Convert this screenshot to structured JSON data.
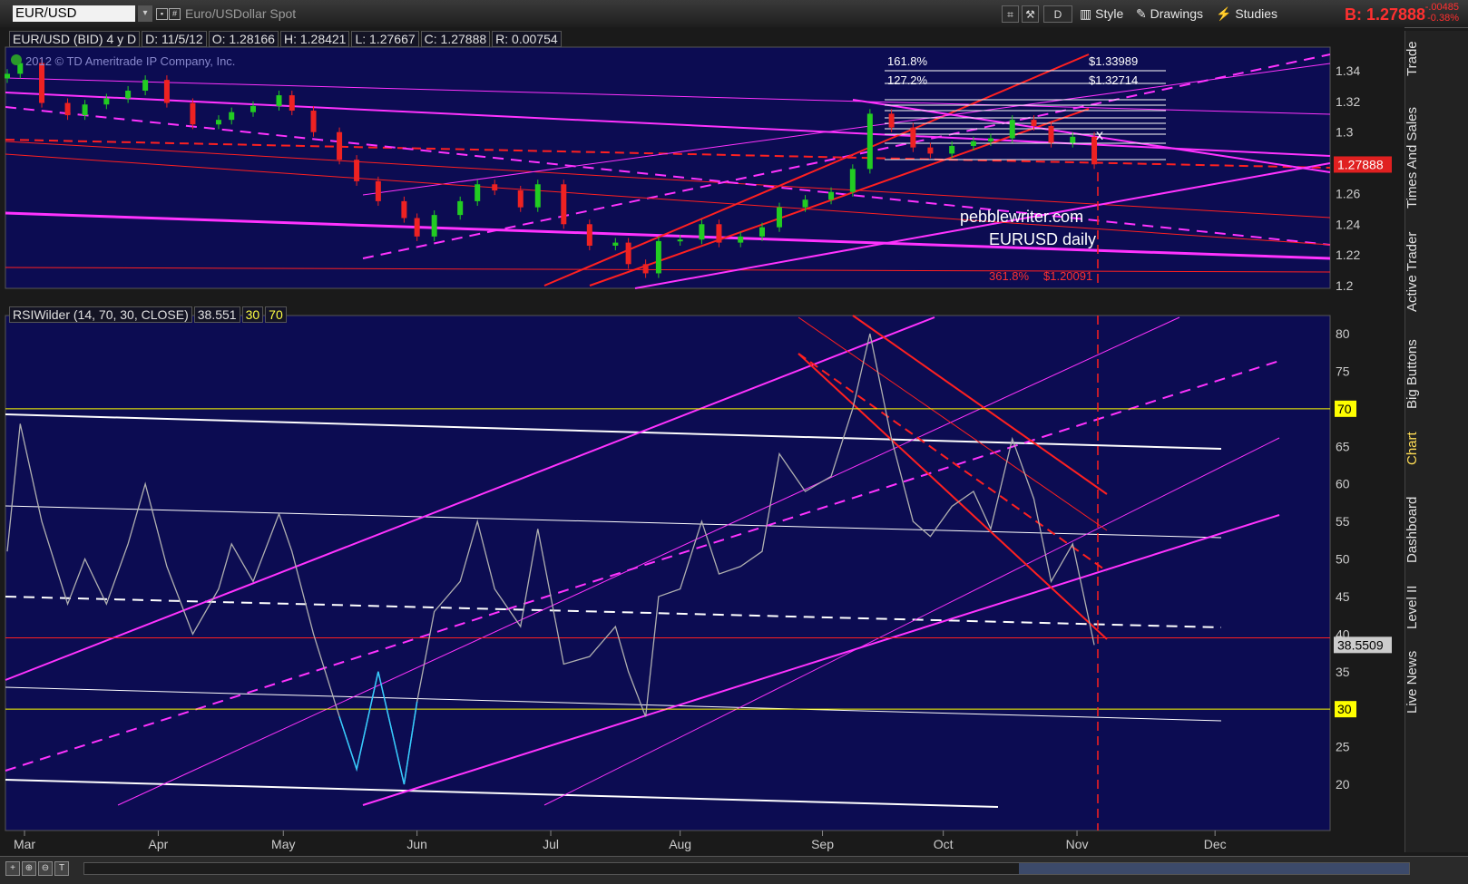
{
  "toolbar": {
    "symbol": "EUR/USD",
    "description": "Euro/USDollar Spot",
    "style_label": "Style",
    "drawings_label": "Drawings",
    "studies_label": "Studies",
    "bid_label": "B: 1.27888",
    "change_abs": "-.00485",
    "change_pct": "-0.38%"
  },
  "price_header": {
    "title": "EUR/USD (BID) 4 y D",
    "date": "D: 11/5/12",
    "open": "O: 1.28166",
    "high": "H: 1.28421",
    "low": "L: 1.27667",
    "close": "C: 1.27888",
    "range": "R: 0.00754"
  },
  "copyright": "2012 © TD Ameritrade IP Company, Inc.",
  "annotations": {
    "site": "pebblewriter.com",
    "subtitle": "EURUSD daily",
    "fib_161": "161.8%",
    "fib_161_val": "$1.33989",
    "fib_127": "127.2%",
    "fib_127_val": "$1.32714",
    "fib_361": "361.8%",
    "fib_361_val": "$1.20091",
    "marker_x": "x"
  },
  "rsi_header": {
    "label": "RSIWilder (14, 70, 30, CLOSE)",
    "value": "38.551",
    "lower": "30",
    "upper": "70"
  },
  "right_tabs": [
    "Trade",
    "Times And Sales",
    "Active Trader",
    "Big Buttons",
    "Chart",
    "Dashboard",
    "Level II",
    "Live News"
  ],
  "active_tab": "Chart",
  "colors": {
    "plot_bg": "#0c0c52",
    "magenta": "#ff33ff",
    "red": "#ff2020",
    "candle_up": "#22cc22",
    "candle_down": "#ee2222",
    "rsi_line": "#b0b0b0",
    "rsi_oversold": "#33ccff",
    "level_yellow": "#ffff00"
  },
  "chart_data": [
    {
      "type": "candlestick",
      "title": "EUR/USD (BID) 4 y D",
      "x_ticks": [
        "Mar",
        "Apr",
        "May",
        "Jun",
        "Jul",
        "Aug",
        "Sep",
        "Oct",
        "Nov",
        "Dec"
      ],
      "y_ticks": [
        "1.34",
        "1.32",
        "1.3",
        "1.28",
        "1.26",
        "1.24",
        "1.22",
        "1.2"
      ],
      "ylim": [
        1.2,
        1.35
      ],
      "last_price": "1.27888",
      "grid": false,
      "close_series": [
        {
          "date": "2012-02-27",
          "close": 1.338
        },
        {
          "date": "2012-03-01",
          "close": 1.345
        },
        {
          "date": "2012-03-06",
          "close": 1.319
        },
        {
          "date": "2012-03-12",
          "close": 1.311
        },
        {
          "date": "2012-03-16",
          "close": 1.318
        },
        {
          "date": "2012-03-21",
          "close": 1.322
        },
        {
          "date": "2012-03-26",
          "close": 1.327
        },
        {
          "date": "2012-03-30",
          "close": 1.334
        },
        {
          "date": "2012-04-04",
          "close": 1.319
        },
        {
          "date": "2012-04-10",
          "close": 1.305
        },
        {
          "date": "2012-04-16",
          "close": 1.308
        },
        {
          "date": "2012-04-19",
          "close": 1.313
        },
        {
          "date": "2012-04-24",
          "close": 1.317
        },
        {
          "date": "2012-04-30",
          "close": 1.324
        },
        {
          "date": "2012-05-03",
          "close": 1.314
        },
        {
          "date": "2012-05-08",
          "close": 1.3
        },
        {
          "date": "2012-05-14",
          "close": 1.282
        },
        {
          "date": "2012-05-18",
          "close": 1.268
        },
        {
          "date": "2012-05-23",
          "close": 1.255
        },
        {
          "date": "2012-05-29",
          "close": 1.244
        },
        {
          "date": "2012-06-01",
          "close": 1.232
        },
        {
          "date": "2012-06-05",
          "close": 1.246
        },
        {
          "date": "2012-06-11",
          "close": 1.255
        },
        {
          "date": "2012-06-15",
          "close": 1.266
        },
        {
          "date": "2012-06-19",
          "close": 1.262
        },
        {
          "date": "2012-06-25",
          "close": 1.251
        },
        {
          "date": "2012-06-29",
          "close": 1.266
        },
        {
          "date": "2012-07-05",
          "close": 1.24
        },
        {
          "date": "2012-07-11",
          "close": 1.226
        },
        {
          "date": "2012-07-17",
          "close": 1.228
        },
        {
          "date": "2012-07-20",
          "close": 1.214
        },
        {
          "date": "2012-07-24",
          "close": 1.208
        },
        {
          "date": "2012-07-27",
          "close": 1.229
        },
        {
          "date": "2012-08-01",
          "close": 1.23
        },
        {
          "date": "2012-08-06",
          "close": 1.24
        },
        {
          "date": "2012-08-10",
          "close": 1.228
        },
        {
          "date": "2012-08-15",
          "close": 1.232
        },
        {
          "date": "2012-08-20",
          "close": 1.238
        },
        {
          "date": "2012-08-24",
          "close": 1.251
        },
        {
          "date": "2012-08-30",
          "close": 1.256
        },
        {
          "date": "2012-09-05",
          "close": 1.261
        },
        {
          "date": "2012-09-10",
          "close": 1.276
        },
        {
          "date": "2012-09-14",
          "close": 1.312
        },
        {
          "date": "2012-09-19",
          "close": 1.303
        },
        {
          "date": "2012-09-24",
          "close": 1.29
        },
        {
          "date": "2012-09-28",
          "close": 1.286
        },
        {
          "date": "2012-10-03",
          "close": 1.291
        },
        {
          "date": "2012-10-08",
          "close": 1.294
        },
        {
          "date": "2012-10-12",
          "close": 1.296
        },
        {
          "date": "2012-10-17",
          "close": 1.308
        },
        {
          "date": "2012-10-22",
          "close": 1.304
        },
        {
          "date": "2012-10-26",
          "close": 1.293
        },
        {
          "date": "2012-10-31",
          "close": 1.297
        },
        {
          "date": "2012-11-05",
          "close": 1.279
        }
      ]
    },
    {
      "type": "line",
      "title": "RSIWilder (14, 70, 30, CLOSE)",
      "y_ticks": [
        "80",
        "75",
        "70",
        "65",
        "60",
        "55",
        "50",
        "45",
        "40",
        "35",
        "30",
        "25",
        "20"
      ],
      "ylim": [
        17,
        84
      ],
      "levels": [
        70,
        30
      ],
      "last_value": "38.5509",
      "series": [
        {
          "date": "2012-02-27",
          "rsi": 51
        },
        {
          "date": "2012-03-01",
          "rsi": 68
        },
        {
          "date": "2012-03-06",
          "rsi": 55
        },
        {
          "date": "2012-03-12",
          "rsi": 44
        },
        {
          "date": "2012-03-16",
          "rsi": 50
        },
        {
          "date": "2012-03-21",
          "rsi": 44
        },
        {
          "date": "2012-03-26",
          "rsi": 52
        },
        {
          "date": "2012-03-30",
          "rsi": 60
        },
        {
          "date": "2012-04-04",
          "rsi": 49
        },
        {
          "date": "2012-04-10",
          "rsi": 40
        },
        {
          "date": "2012-04-16",
          "rsi": 46
        },
        {
          "date": "2012-04-19",
          "rsi": 52
        },
        {
          "date": "2012-04-24",
          "rsi": 47
        },
        {
          "date": "2012-04-30",
          "rsi": 56
        },
        {
          "date": "2012-05-03",
          "rsi": 51
        },
        {
          "date": "2012-05-08",
          "rsi": 40
        },
        {
          "date": "2012-05-14",
          "rsi": 29
        },
        {
          "date": "2012-05-18",
          "rsi": 22
        },
        {
          "date": "2012-05-23",
          "rsi": 35
        },
        {
          "date": "2012-05-29",
          "rsi": 20
        },
        {
          "date": "2012-06-01",
          "rsi": 31
        },
        {
          "date": "2012-06-05",
          "rsi": 43
        },
        {
          "date": "2012-06-11",
          "rsi": 47
        },
        {
          "date": "2012-06-15",
          "rsi": 55
        },
        {
          "date": "2012-06-19",
          "rsi": 46
        },
        {
          "date": "2012-06-25",
          "rsi": 41
        },
        {
          "date": "2012-06-29",
          "rsi": 54
        },
        {
          "date": "2012-07-05",
          "rsi": 36
        },
        {
          "date": "2012-07-11",
          "rsi": 37
        },
        {
          "date": "2012-07-17",
          "rsi": 41
        },
        {
          "date": "2012-07-20",
          "rsi": 35
        },
        {
          "date": "2012-07-24",
          "rsi": 29
        },
        {
          "date": "2012-07-27",
          "rsi": 45
        },
        {
          "date": "2012-08-01",
          "rsi": 46
        },
        {
          "date": "2012-08-06",
          "rsi": 55
        },
        {
          "date": "2012-08-10",
          "rsi": 48
        },
        {
          "date": "2012-08-15",
          "rsi": 49
        },
        {
          "date": "2012-08-20",
          "rsi": 51
        },
        {
          "date": "2012-08-24",
          "rsi": 64
        },
        {
          "date": "2012-08-30",
          "rsi": 59
        },
        {
          "date": "2012-09-05",
          "rsi": 61
        },
        {
          "date": "2012-09-10",
          "rsi": 70
        },
        {
          "date": "2012-09-14",
          "rsi": 80
        },
        {
          "date": "2012-09-19",
          "rsi": 66
        },
        {
          "date": "2012-09-24",
          "rsi": 55
        },
        {
          "date": "2012-09-28",
          "rsi": 53
        },
        {
          "date": "2012-10-03",
          "rsi": 57
        },
        {
          "date": "2012-10-08",
          "rsi": 59
        },
        {
          "date": "2012-10-12",
          "rsi": 54
        },
        {
          "date": "2012-10-17",
          "rsi": 66
        },
        {
          "date": "2012-10-22",
          "rsi": 58
        },
        {
          "date": "2012-10-26",
          "rsi": 47
        },
        {
          "date": "2012-10-31",
          "rsi": 52
        },
        {
          "date": "2012-11-05",
          "rsi": 38.55
        }
      ]
    }
  ]
}
